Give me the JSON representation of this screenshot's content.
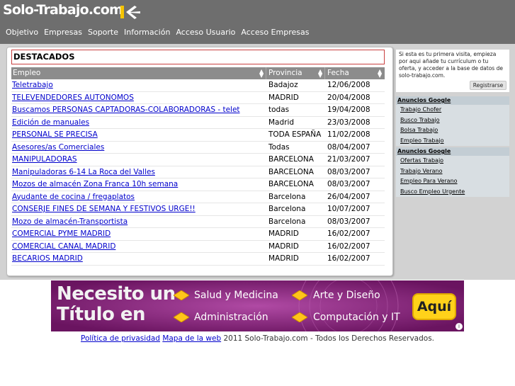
{
  "header": {
    "logo_text": "Solo-Trabajo.com",
    "nav": [
      "Objetivo",
      "Empresas",
      "Soporte",
      "Información",
      "Acceso Usuario",
      "Acceso Empresas"
    ]
  },
  "main": {
    "title": "DESTACADOS",
    "columns": [
      "Empleo",
      "Provincia",
      "Fecha"
    ],
    "rows": [
      [
        "Teletrabajo",
        "Badajoz",
        "12/06/2008"
      ],
      [
        "TELEVENDEDORES AUTONOMOS",
        "MADRID",
        "20/04/2008"
      ],
      [
        "Buscamos PERSONAS CAPTADORAS-COLABORADORAS - telet",
        "todas",
        "19/04/2008"
      ],
      [
        "Edición de manuales",
        "Madrid",
        "23/03/2008"
      ],
      [
        "PERSONAL SE PRECISA",
        "TODA ESPAÑA",
        "11/02/2008"
      ],
      [
        "Asesores/as Comerciales",
        "Todas",
        "08/04/2007"
      ],
      [
        "MANIPULADORAS",
        "BARCELONA",
        "21/03/2007"
      ],
      [
        "Manipuladoras 6-14 La Roca del Valles",
        "BARCELONA",
        "08/03/2007"
      ],
      [
        "Mozos de almacén Zona Franca 10h semana",
        "BARCELONA",
        "08/03/2007"
      ],
      [
        "Ayudante de cocina / fregaplatos",
        "Barcelona",
        "26/04/2007"
      ],
      [
        "CONSERJE FINES DE SEMANA Y FESTIVOS URGE!!",
        "Barcelona",
        "10/07/2007"
      ],
      [
        "Mozo de almacén-Transportista",
        "Barcelona",
        "08/03/2007"
      ],
      [
        "COMERCIAL PYME MADRID",
        "MADRID",
        "16/02/2007"
      ],
      [
        "COMERCIAL CANAL MADRID",
        "MADRID",
        "16/02/2007"
      ],
      [
        "BECARIOS MADRID",
        "MADRID",
        "16/02/2007"
      ]
    ]
  },
  "sidebar": {
    "info_text": "Si esta es tu primera visita, empieza por aqui añade tu currículum o tu oferta, y acceder a la base de datos de solo-trabajo.com.",
    "register_label": "Registrarse",
    "ads": [
      {
        "title": "Anuncios Google",
        "links": [
          "Trabajo Chofer",
          "Busco Trabajo",
          "Bolsa Trabajo",
          "Empleo Trabajo"
        ]
      },
      {
        "title": "Anuncios Google",
        "links": [
          "Ofertas Trabajo",
          "Trabajo Verano",
          "Empleo Para Verano",
          "Busco Empleo Urgente"
        ]
      }
    ]
  },
  "banner": {
    "line1": "Necesito un",
    "line2": "Título en",
    "items": [
      "Salud y Medicina",
      "Arte y Diseño",
      "Administración",
      "Computación y IT"
    ],
    "cta": "Aquí",
    "info_icon": "i"
  },
  "footer": {
    "privacy_link": "Política de privasidad",
    "sitemap_link": "Mapa de la web",
    "copyright": "2011 Solo-Trabajo.com - Todos los Derechos Reservados."
  },
  "colors": {
    "header_bg": "#6e6e6e",
    "band_bg": "#d2d2d2",
    "link": "#0000cc",
    "banner_bg": "#7b1c6e",
    "cta": "#ffd21a"
  }
}
